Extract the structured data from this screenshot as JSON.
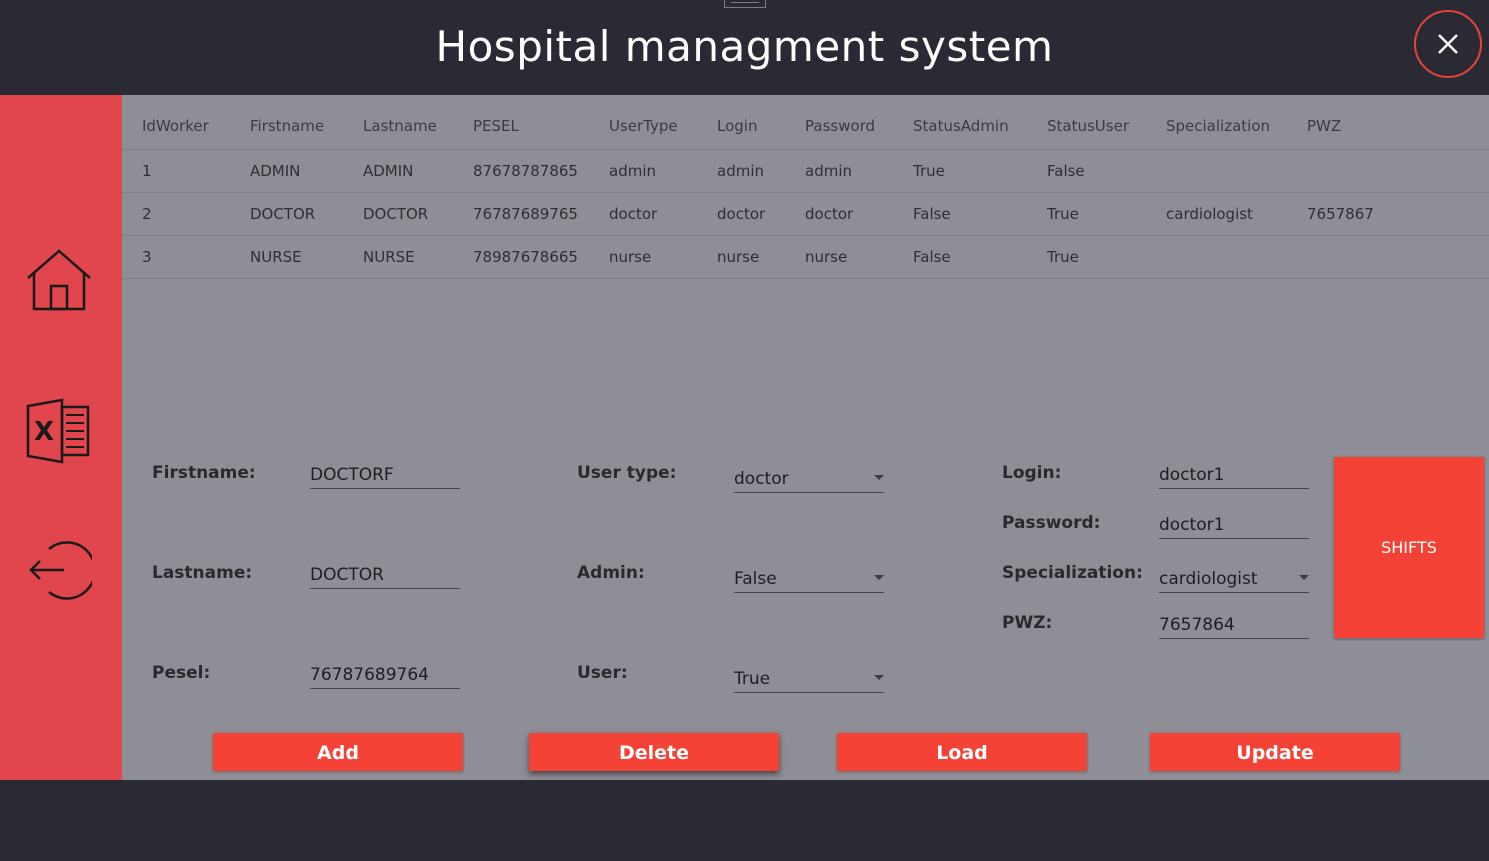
{
  "app": {
    "title": "Hospital managment system"
  },
  "table": {
    "columns": [
      "IdWorker",
      "Firstname",
      "Lastname",
      "PESEL",
      "UserType",
      "Login",
      "Password",
      "StatusAdmin",
      "StatusUser",
      "Specialization",
      "PWZ"
    ],
    "rows": [
      [
        "1",
        "ADMIN",
        "ADMIN",
        "87678787865",
        "admin",
        "admin",
        "admin",
        "True",
        "False",
        "",
        ""
      ],
      [
        "2",
        "DOCTOR",
        "DOCTOR",
        "76787689765",
        "doctor",
        "doctor",
        "doctor",
        "False",
        "True",
        "cardiologist",
        "7657867"
      ],
      [
        "3",
        "NURSE",
        "NURSE",
        "78987678665",
        "nurse",
        "nurse",
        "nurse",
        "False",
        "True",
        "",
        ""
      ]
    ]
  },
  "form": {
    "firstname": {
      "label": "Firstname:",
      "value": "DOCTORF"
    },
    "lastname": {
      "label": "Lastname:",
      "value": "DOCTOR"
    },
    "pesel": {
      "label": "Pesel:",
      "value": "76787689764"
    },
    "usertype": {
      "label": "User type:",
      "value": "doctor"
    },
    "admin": {
      "label": "Admin:",
      "value": "False"
    },
    "user": {
      "label": "User:",
      "value": "True"
    },
    "login": {
      "label": "Login:",
      "value": "doctor1"
    },
    "password": {
      "label": "Password:",
      "value": "doctor1"
    },
    "specialization": {
      "label": "Specialization:",
      "value": "cardiologist"
    },
    "pwz": {
      "label": "PWZ:",
      "value": "7657864"
    }
  },
  "buttons": {
    "shifts": "SHIFTS",
    "add": "Add",
    "delete": "Delete",
    "load": "Load",
    "update": "Update"
  },
  "icons": {
    "close": "close-icon",
    "home": "home-icon",
    "excel": "excel-icon",
    "logout": "logout-icon"
  },
  "colors": {
    "accent": "#f44336",
    "sidebar": "#e0464c",
    "header": "#2a2a35",
    "content": "#8e8f96"
  }
}
